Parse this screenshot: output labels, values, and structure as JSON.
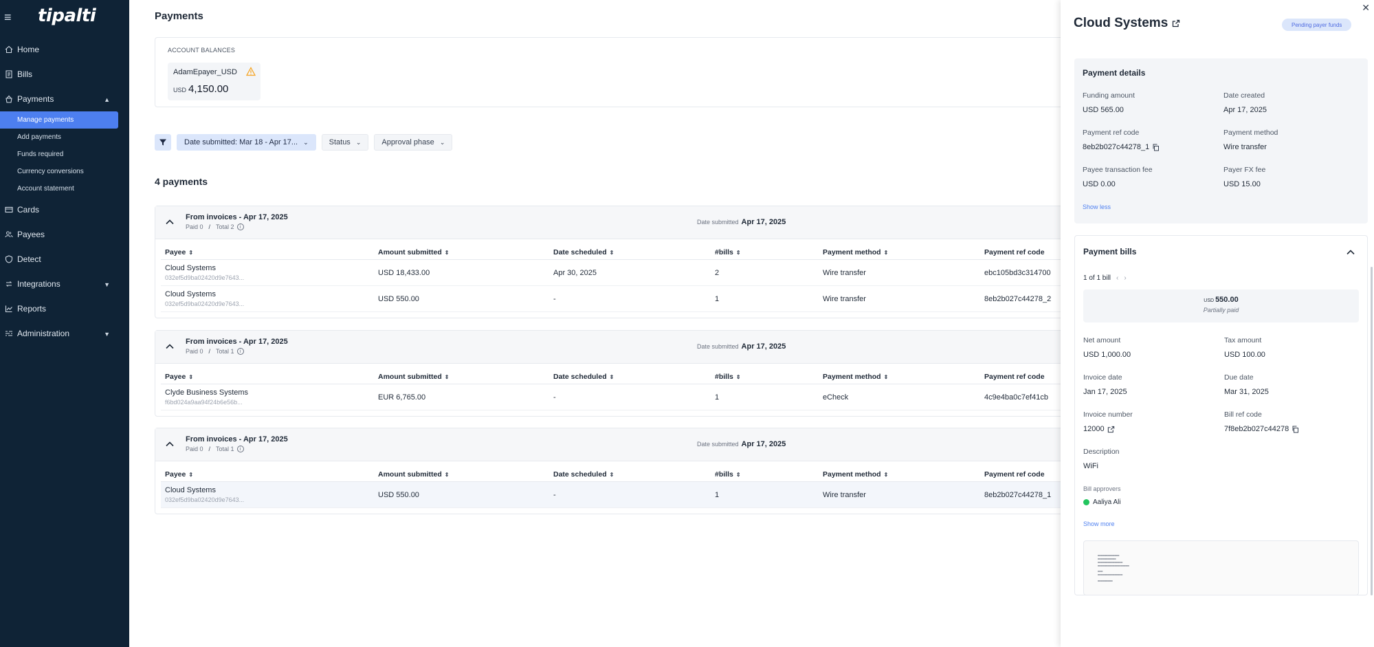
{
  "app": {
    "brand": "tipalti",
    "page_title": "Payments"
  },
  "sidebar": {
    "items": [
      {
        "label": "Home",
        "icon": "home-icon"
      },
      {
        "label": "Bills",
        "icon": "bills-icon"
      },
      {
        "label": "Payments",
        "icon": "payments-icon"
      },
      {
        "label": "Cards",
        "icon": "card-icon"
      },
      {
        "label": "Payees",
        "icon": "payees-icon"
      },
      {
        "label": "Detect",
        "icon": "detect-icon"
      },
      {
        "label": "Integrations",
        "icon": "integrations-icon"
      },
      {
        "label": "Reports",
        "icon": "reports-icon"
      },
      {
        "label": "Administration",
        "icon": "administration-icon"
      }
    ],
    "payments_sub": [
      {
        "label": "Manage payments",
        "active": true
      },
      {
        "label": "Add payments"
      },
      {
        "label": "Funds required"
      },
      {
        "label": "Currency conversions"
      },
      {
        "label": "Account statement"
      }
    ]
  },
  "balances": {
    "label": "ACCOUNT BALANCES",
    "account_name": "AdamEpayer_USD",
    "currency": "USD",
    "amount": "4,150.00"
  },
  "filters": {
    "date_chip": "Date submitted:  Mar 18 - Apr 17...",
    "status": "Status",
    "approval": "Approval phase"
  },
  "payments_count": "4 payments",
  "columns": {
    "payee": "Payee",
    "amount": "Amount submitted",
    "date": "Date scheduled",
    "bills": "#bills",
    "method": "Payment method",
    "ref": "Payment ref code"
  },
  "groups": [
    {
      "title": "From invoices - Apr 17, 2025",
      "paid": "Paid 0",
      "total": "Total 2",
      "date_label": "Date submitted",
      "date": "Apr 17, 2025",
      "rows": [
        {
          "payee": "Cloud Systems",
          "id": "032ef5d9ba02420d9e7643...",
          "amount": "USD 18,433.00",
          "date": "Apr 30, 2025",
          "bills": "2",
          "method": "Wire transfer",
          "ref": "ebc105bd3c314700"
        },
        {
          "payee": "Cloud Systems",
          "id": "032ef5d9ba02420d9e7643...",
          "amount": "USD 550.00",
          "date": "-",
          "bills": "1",
          "method": "Wire transfer",
          "ref": "8eb2b027c44278_2"
        }
      ]
    },
    {
      "title": "From invoices - Apr 17, 2025",
      "paid": "Paid 0",
      "total": "Total 1",
      "date_label": "Date submitted",
      "date": "Apr 17, 2025",
      "rows": [
        {
          "payee": "Clyde Business Systems",
          "id": "f6bd024a9aa94f24b6e56b...",
          "amount": "EUR 6,765.00",
          "date": "-",
          "bills": "1",
          "method": "eCheck",
          "ref": "4c9e4ba0c7ef41cb"
        }
      ]
    },
    {
      "title": "From invoices - Apr 17, 2025",
      "paid": "Paid 0",
      "total": "Total 1",
      "date_label": "Date submitted",
      "date": "Apr 17, 2025",
      "rows": [
        {
          "payee": "Cloud Systems",
          "id": "032ef5d9ba02420d9e7643...",
          "amount": "USD 550.00",
          "date": "-",
          "bills": "1",
          "method": "Wire transfer",
          "ref": "8eb2b027c44278_1"
        }
      ]
    }
  ],
  "panel": {
    "title": "Cloud Systems",
    "badge": "Pending payer funds",
    "details": {
      "title": "Payment details",
      "funding_amount_label": "Funding amount",
      "funding_amount": "USD 565.00",
      "date_created_label": "Date created",
      "date_created": "Apr 17, 2025",
      "ref_code_label": "Payment ref code",
      "ref_code": "8eb2b027c44278_1",
      "method_label": "Payment method",
      "method": "Wire transfer",
      "payee_fee_label": "Payee transaction fee",
      "payee_fee": "USD 0.00",
      "fx_fee_label": "Payer FX fee",
      "fx_fee": "USD 15.00",
      "show_less": "Show less"
    },
    "bills": {
      "title": "Payment bills",
      "pager": "1 of 1 bill",
      "bill_currency": "USD",
      "bill_amount": "550.00",
      "bill_status": "Partially paid",
      "net_label": "Net amount",
      "net": "USD 1,000.00",
      "tax_label": "Tax amount",
      "tax": "USD 100.00",
      "invoice_date_label": "Invoice date",
      "invoice_date": "Jan 17, 2025",
      "due_date_label": "Due date",
      "due_date": "Mar 31, 2025",
      "invoice_number_label": "Invoice number",
      "invoice_number": "12000",
      "bill_ref_label": "Bill ref code",
      "bill_ref": "7f8eb2b027c44278",
      "description_label": "Description",
      "description": "WiFi",
      "approvers_label": "Bill approvers",
      "approver": "Aaliya Ali",
      "show_more": "Show more"
    }
  }
}
